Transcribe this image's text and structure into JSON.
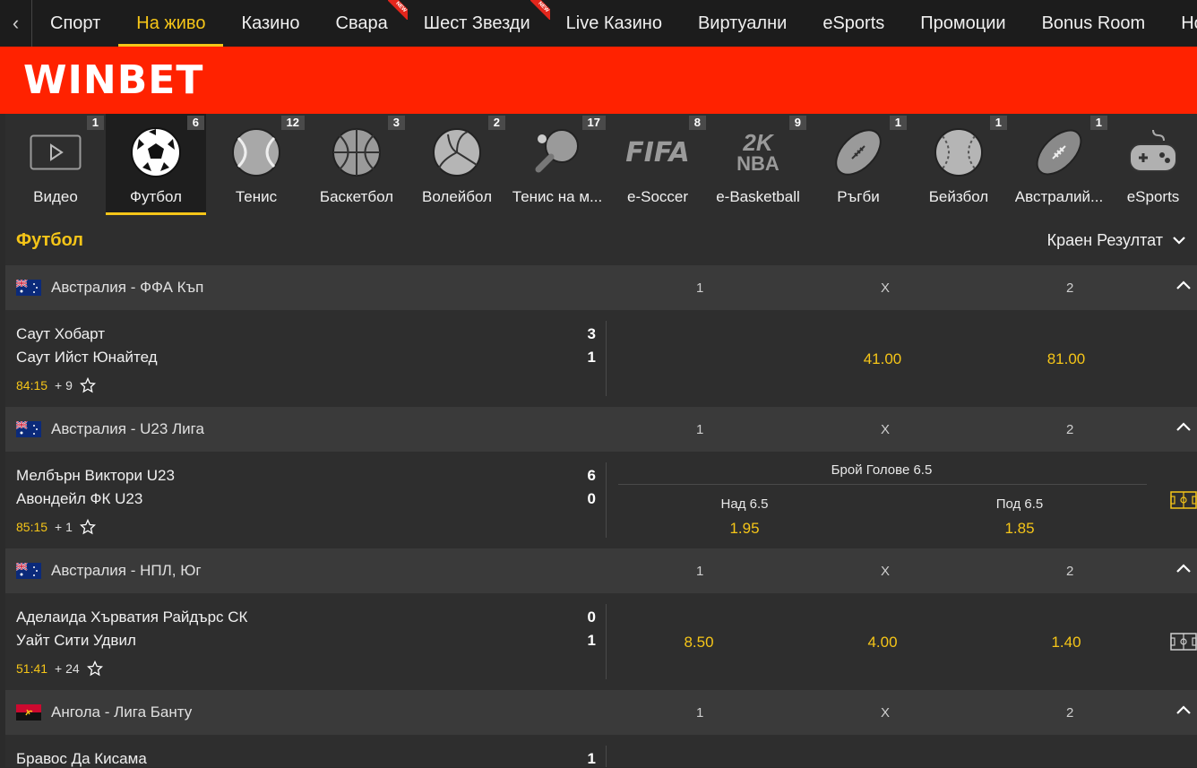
{
  "topnav": {
    "items": [
      {
        "label": "Спорт",
        "new": false,
        "active": false
      },
      {
        "label": "На живо",
        "new": false,
        "active": true
      },
      {
        "label": "Казино",
        "new": false,
        "active": false
      },
      {
        "label": "Свара",
        "new": true,
        "active": false
      },
      {
        "label": "Шест Звезди",
        "new": true,
        "active": false
      },
      {
        "label": "Live Казино",
        "new": false,
        "active": false
      },
      {
        "label": "Виртуални",
        "new": false,
        "active": false
      },
      {
        "label": "eSports",
        "new": false,
        "active": false
      },
      {
        "label": "Промоции",
        "new": false,
        "active": false
      },
      {
        "label": "Bonus Room",
        "new": false,
        "active": false
      },
      {
        "label": "Нов",
        "new": false,
        "active": false
      }
    ],
    "new_badge": "NEW"
  },
  "brand": {
    "logo": "WINBET",
    "color": "#ff2200"
  },
  "sports": [
    {
      "label": "Видео",
      "count": "1",
      "icon": "video-play-icon"
    },
    {
      "label": "Футбол",
      "count": "6",
      "icon": "soccer-ball-icon",
      "active": true
    },
    {
      "label": "Тенис",
      "count": "12",
      "icon": "tennis-ball-icon"
    },
    {
      "label": "Баскетбол",
      "count": "3",
      "icon": "basketball-icon"
    },
    {
      "label": "Волейбол",
      "count": "2",
      "icon": "volleyball-icon"
    },
    {
      "label": "Тенис на м...",
      "count": "17",
      "icon": "table-tennis-icon"
    },
    {
      "label": "e-Soccer",
      "count": "8",
      "icon": "fifa-icon",
      "icon_text": "FIFA"
    },
    {
      "label": "e-Basketball",
      "count": "9",
      "icon": "nba2k-icon",
      "icon_text": "2K NBA"
    },
    {
      "label": "Ръгби",
      "count": "1",
      "icon": "rugby-ball-icon"
    },
    {
      "label": "Бейзбол",
      "count": "1",
      "icon": "baseball-icon"
    },
    {
      "label": "Австралий...",
      "count": "1",
      "icon": "aussie-rules-ball-icon"
    },
    {
      "label": "eSports",
      "count": "",
      "icon": "gamepad-icon"
    }
  ],
  "section": {
    "title": "Футбол",
    "market": "Краен Резултат"
  },
  "columns": {
    "home": "1",
    "draw": "X",
    "away": "2"
  },
  "leagues": [
    {
      "name": "Австралия - ФФА Къп",
      "flag": "australia-flag-icon",
      "match": {
        "home": "Саут Хобарт",
        "away": "Саут Ийст Юнайтед",
        "home_score": "3",
        "away_score": "1",
        "time": "84:15",
        "more": "+ 9",
        "odds": {
          "home": "",
          "draw": "41.00",
          "away": "81.00"
        }
      }
    },
    {
      "name": "Австралия - U23 Лига",
      "flag": "australia-flag-icon",
      "match": {
        "home": "Мелбърн Виктори U23",
        "away": "Авондейл ФК U23",
        "home_score": "6",
        "away_score": "0",
        "time": "85:15",
        "more": "+ 1",
        "market_title": "Брой Голове 6.5",
        "over_label": "Над 6.5",
        "over_odd": "1.95",
        "under_label": "Под 6.5",
        "under_odd": "1.85"
      }
    },
    {
      "name": "Австралия - НПЛ, Юг",
      "flag": "australia-flag-icon",
      "match": {
        "home": "Аделаида Хърватия Райдърс СК",
        "away": "Уайт Сити Удвил",
        "home_score": "0",
        "away_score": "1",
        "time": "51:41",
        "more": "+ 24",
        "odds": {
          "home": "8.50",
          "draw": "4.00",
          "away": "1.40"
        }
      }
    },
    {
      "name": "Ангола - Лига Банту",
      "flag": "angola-flag-icon",
      "match": {
        "home": "Бравос Да Кисама",
        "home_score": "1"
      }
    }
  ],
  "colors": {
    "accent": "#f5c518",
    "brand": "#ff2200",
    "dark": "#1c1c1c",
    "panel": "#2e2e2e",
    "league": "#3a3a3a"
  }
}
